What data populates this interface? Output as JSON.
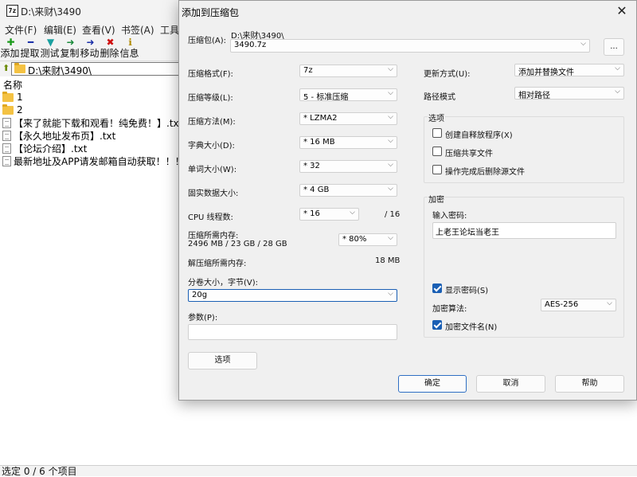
{
  "main_window": {
    "app_icon_text": "7z",
    "title": "D:\\来财\\3490",
    "menu": [
      "文件(F)",
      "编辑(E)",
      "查看(V)",
      "书签(A)",
      "工具"
    ],
    "toolbar": [
      {
        "label": "添加",
        "icon": "add-icon",
        "color": "#1a9a1a",
        "glyph": "✚"
      },
      {
        "label": "提取",
        "icon": "extract-icon",
        "color": "#1a2fa8",
        "glyph": "━"
      },
      {
        "label": "测试",
        "icon": "test-icon",
        "color": "#1aa0a0",
        "glyph": "▼"
      },
      {
        "label": "复制",
        "icon": "copy-icon",
        "color": "#1a8a3a",
        "glyph": "➜"
      },
      {
        "label": "移动",
        "icon": "move-icon",
        "color": "#1a2fa8",
        "glyph": "➜"
      },
      {
        "label": "删除",
        "icon": "delete-icon",
        "color": "#d01010",
        "glyph": "✖"
      },
      {
        "label": "信息",
        "icon": "info-icon",
        "color": "#b08a00",
        "glyph": "ℹ"
      }
    ],
    "address": "D:\\来财\\3490\\",
    "column_name": "名称",
    "files": [
      {
        "name": "1",
        "type": "folder"
      },
      {
        "name": "2",
        "type": "folder"
      },
      {
        "name": "【来了就能下载和观看！纯免费！】.txt",
        "type": "txt"
      },
      {
        "name": "【永久地址发布页】.txt",
        "type": "txt"
      },
      {
        "name": "【论坛介绍】.txt",
        "type": "txt"
      },
      {
        "name": "最新地址及APP请发邮箱自动获取！！！.txt",
        "type": "txt"
      }
    ],
    "status": "选定 0 / 6 个项目"
  },
  "dialog": {
    "title": "添加到压缩包",
    "close_icon": "close-icon",
    "archive_label": "压缩包(A):",
    "archive_path": "D:\\来财\\3490\\",
    "archive_name": "3490.7z",
    "browse_label": "...",
    "left": {
      "format_label": "压缩格式(F):",
      "format_value": "7z",
      "level_label": "压缩等级(L):",
      "level_value": "5 - 标准压缩",
      "method_label": "压缩方法(M):",
      "method_value": "*  LZMA2",
      "dict_label": "字典大小(D):",
      "dict_value": "*  16 MB",
      "word_label": "单词大小(W):",
      "word_value": "*  32",
      "solid_label": "固实数据大小:",
      "solid_value": "*  4 GB",
      "cpu_label": "CPU 线程数:",
      "cpu_value": "*  16",
      "cpu_total": "/ 16",
      "mem_label": "压缩所需内存:",
      "mem_value": "2496 MB / 23 GB / 28 GB",
      "mem_percent": "* 80%",
      "decomp_label": "解压缩所需内存:",
      "decomp_value": "18 MB",
      "split_label": "分卷大小，字节(V):",
      "split_value": "20g",
      "params_label": "参数(P):",
      "params_value": "",
      "options_button": "选项"
    },
    "right": {
      "update_label": "更新方式(U):",
      "update_value": "添加并替换文件",
      "path_label": "路径模式",
      "path_value": "相对路径",
      "options_group": "选项",
      "options": [
        {
          "label": "创建自释放程序(X)",
          "checked": false
        },
        {
          "label": "压缩共享文件",
          "checked": false
        },
        {
          "label": "操作完成后删除源文件",
          "checked": false
        }
      ],
      "encrypt_group": "加密",
      "password_label": "输入密码:",
      "password_value": "上老王论坛当老王",
      "show_password_label": "显示密码(S)",
      "show_password_checked": true,
      "enc_method_label": "加密算法:",
      "enc_method_value": "AES-256",
      "encrypt_names_label": "加密文件名(N)",
      "encrypt_names_checked": true
    },
    "buttons": {
      "ok": "确定",
      "cancel": "取消",
      "help": "帮助"
    }
  }
}
